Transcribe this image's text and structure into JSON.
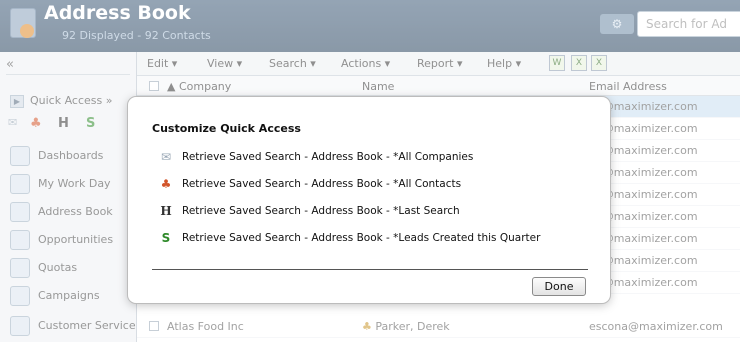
{
  "header": {
    "title": "Address Book",
    "subtitle": "92 Displayed - 92 Contacts",
    "search_placeholder": "Search for Ad"
  },
  "sidebar": {
    "collapse": "«",
    "quick_access": "Quick Access",
    "quick_access_more": "»",
    "items": [
      {
        "label": "Dashboards",
        "icon": "dashboard-icon"
      },
      {
        "label": "My Work Day",
        "icon": "calendar-icon"
      },
      {
        "label": "Address Book",
        "icon": "address-book-icon"
      },
      {
        "label": "Opportunities",
        "icon": "opportunities-icon"
      },
      {
        "label": "Quotas",
        "icon": "quotas-icon"
      },
      {
        "label": "Campaigns",
        "icon": "campaigns-icon"
      },
      {
        "label": "Customer Service",
        "icon": "customer-service-icon"
      }
    ]
  },
  "toolbar": {
    "edit": "Edit ▾",
    "view": "View ▾",
    "search": "Search ▾",
    "actions": "Actions ▾",
    "report": "Report ▾",
    "help": "Help ▾"
  },
  "columns": {
    "company": "▲ Company",
    "name": "Name",
    "email": "Email Address"
  },
  "rows": [
    {
      "email": "na@maximizer.com"
    },
    {
      "email": "na@maximizer.com"
    },
    {
      "email": "na@maximizer.com"
    },
    {
      "email": "na@maximizer.com"
    },
    {
      "email": "na@maximizer.com"
    },
    {
      "email": "na@maximizer.com"
    },
    {
      "email": "na@maximizer.com"
    },
    {
      "email": "na@maximizer.com"
    },
    {
      "email": "na@maximizer.com"
    },
    {
      "company": "Atlas Food Inc",
      "name": "Parker, Derek",
      "email": "escona@maximizer.com"
    }
  ],
  "dialog": {
    "title": "Customize Quick Access",
    "items": [
      {
        "label": "Retrieve Saved Search - Address Book - *All Companies",
        "icon": "envelope-icon"
      },
      {
        "label": "Retrieve Saved Search - Address Book - *All Contacts",
        "icon": "contacts-icon"
      },
      {
        "label": "Retrieve Saved Search - Address Book - *Last Search",
        "icon": "last-search-icon"
      },
      {
        "label": "Retrieve Saved Search - Address Book - *Leads Created this Quarter",
        "icon": "dollar-icon"
      }
    ],
    "done": "Done"
  },
  "colors": {
    "header_bg": "#2f4b67",
    "selected_row": "#c9dff0"
  }
}
